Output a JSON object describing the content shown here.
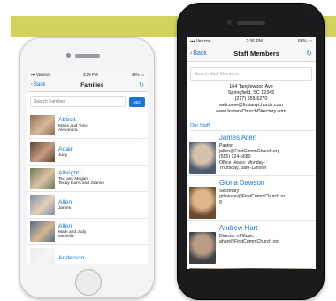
{
  "left_phone": {
    "status": {
      "carrier": "Verizon",
      "time": "3:29 PM",
      "battery": "43%"
    },
    "nav": {
      "back": "Back",
      "title": "Families"
    },
    "search": {
      "placeholder": "Search Families",
      "abc_label": "ABC"
    },
    "families": [
      {
        "name": "Abbott",
        "members": [
          "Marie and Tony",
          "Alexandra"
        ],
        "photo_colors": [
          "#8a6e5a",
          "#d8b99a"
        ]
      },
      {
        "name": "Adair",
        "members": [
          "Judy"
        ],
        "photo_colors": [
          "#5a4336",
          "#c59b80"
        ]
      },
      {
        "name": "Albright",
        "members": [
          "Ted and Megan",
          "Teddy Barrs and Joanne"
        ],
        "photo_colors": [
          "#6d7c5b",
          "#d9c2a2"
        ]
      },
      {
        "name": "Allen",
        "members": [
          "James"
        ],
        "photo_colors": [
          "#7d8fa8",
          "#e5cfb8"
        ]
      },
      {
        "name": "Allen",
        "members": [
          "Mark and Judy",
          "Michelle"
        ],
        "photo_colors": [
          "#4f6f8b",
          "#d7b491"
        ]
      },
      {
        "name": "Anderson",
        "members": [],
        "photo_colors": [
          "#c8c8c8",
          "#e5e5e5"
        ]
      }
    ]
  },
  "right_phone": {
    "status": {
      "carrier": "Verizon",
      "time": "2:36 PM",
      "battery": "66%"
    },
    "nav": {
      "back": "Back",
      "title": "Staff Members"
    },
    "search": {
      "placeholder": "Search Staff Members"
    },
    "church": {
      "address1": "164 Tanglewood Ave",
      "address2": "Springfield, SC 12345",
      "phone": "(217) 555-6270",
      "email": "welcome@firstanychurch.com",
      "website": "www.InstantChurchDirectory.com"
    },
    "section_label": "Our Staff",
    "staff": [
      {
        "name": "James Allen",
        "lines": [
          "Pastor",
          "jallen@FirstCommChurch.org",
          "(555) 124-5680",
          "Office Hours: Monday-",
          "Thursday, 8am-12noon"
        ],
        "photo_colors": [
          "#4c5a6e",
          "#d6c1ad"
        ]
      },
      {
        "name": "Gloria Dawson",
        "lines": [
          "Secretary",
          "gdawson@FirstCommChurch.or",
          "g"
        ],
        "photo_colors": [
          "#6b4a34",
          "#e0b58a"
        ]
      },
      {
        "name": "Andrew Hart",
        "lines": [
          "Director of Music",
          "ahart@FirstCommChurch.org"
        ],
        "photo_colors": [
          "#3d3f44",
          "#b99c86"
        ]
      }
    ]
  },
  "colors": {
    "accent_band": "#d2d35e",
    "link_blue": "#1a73d9"
  }
}
